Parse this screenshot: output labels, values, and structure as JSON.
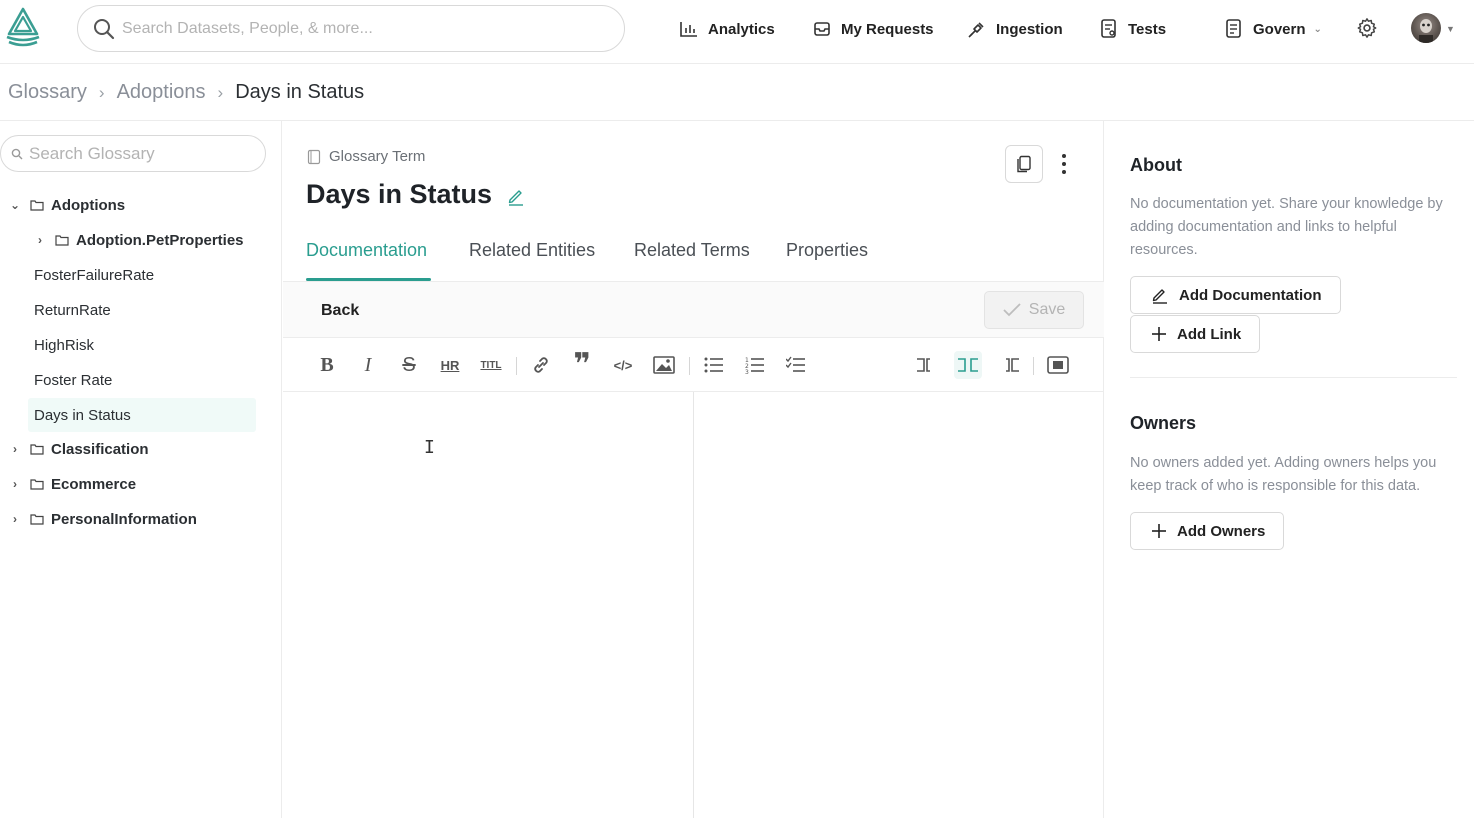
{
  "nav": {
    "search_placeholder": "Search Datasets, People, & more...",
    "items": [
      {
        "label": "Analytics",
        "icon": "bar-chart-icon"
      },
      {
        "label": "My Requests",
        "icon": "inbox-icon"
      },
      {
        "label": "Ingestion",
        "icon": "plug-icon"
      },
      {
        "label": "Tests",
        "icon": "test-file-icon"
      },
      {
        "label": "Govern",
        "icon": "govern-icon"
      }
    ]
  },
  "breadcrumb": [
    "Glossary",
    "Adoptions",
    "Days in Status"
  ],
  "sidebar": {
    "search_placeholder": "Search Glossary",
    "tree": [
      {
        "label": "Adoptions",
        "expanded": true
      },
      {
        "label": "Adoption.PetProperties",
        "expanded": false
      },
      {
        "label": "FosterFailureRate"
      },
      {
        "label": "ReturnRate"
      },
      {
        "label": "HighRisk"
      },
      {
        "label": "Foster Rate"
      },
      {
        "label": "Days in Status",
        "selected": true
      },
      {
        "label": "Classification",
        "expanded": false
      },
      {
        "label": "Ecommerce",
        "expanded": false
      },
      {
        "label": "PersonalInformation",
        "expanded": false
      }
    ]
  },
  "main": {
    "type_label": "Glossary Term",
    "title": "Days in Status",
    "tabs": [
      "Documentation",
      "Related Entities",
      "Related Terms",
      "Properties"
    ],
    "active_tab": "Documentation",
    "back_label": "Back",
    "save_label": "Save",
    "cursor_glyph": "I",
    "toolbar": {
      "bold": "B",
      "italic": "I",
      "strike": "S",
      "hr": "HR",
      "title": "TITL",
      "quote": "❞",
      "code": "</>"
    }
  },
  "right": {
    "about_title": "About",
    "about_text": "No documentation yet. Share your knowledge by adding documentation and links to helpful resources.",
    "add_documentation": "Add Documentation",
    "add_link": "Add Link",
    "owners_title": "Owners",
    "owners_text": "No owners added yet. Adding owners helps you keep track of who is responsible for this data.",
    "add_owners": "Add Owners"
  },
  "colors": {
    "accent": "#2a9d8f",
    "logo": "#2a9d8f"
  }
}
